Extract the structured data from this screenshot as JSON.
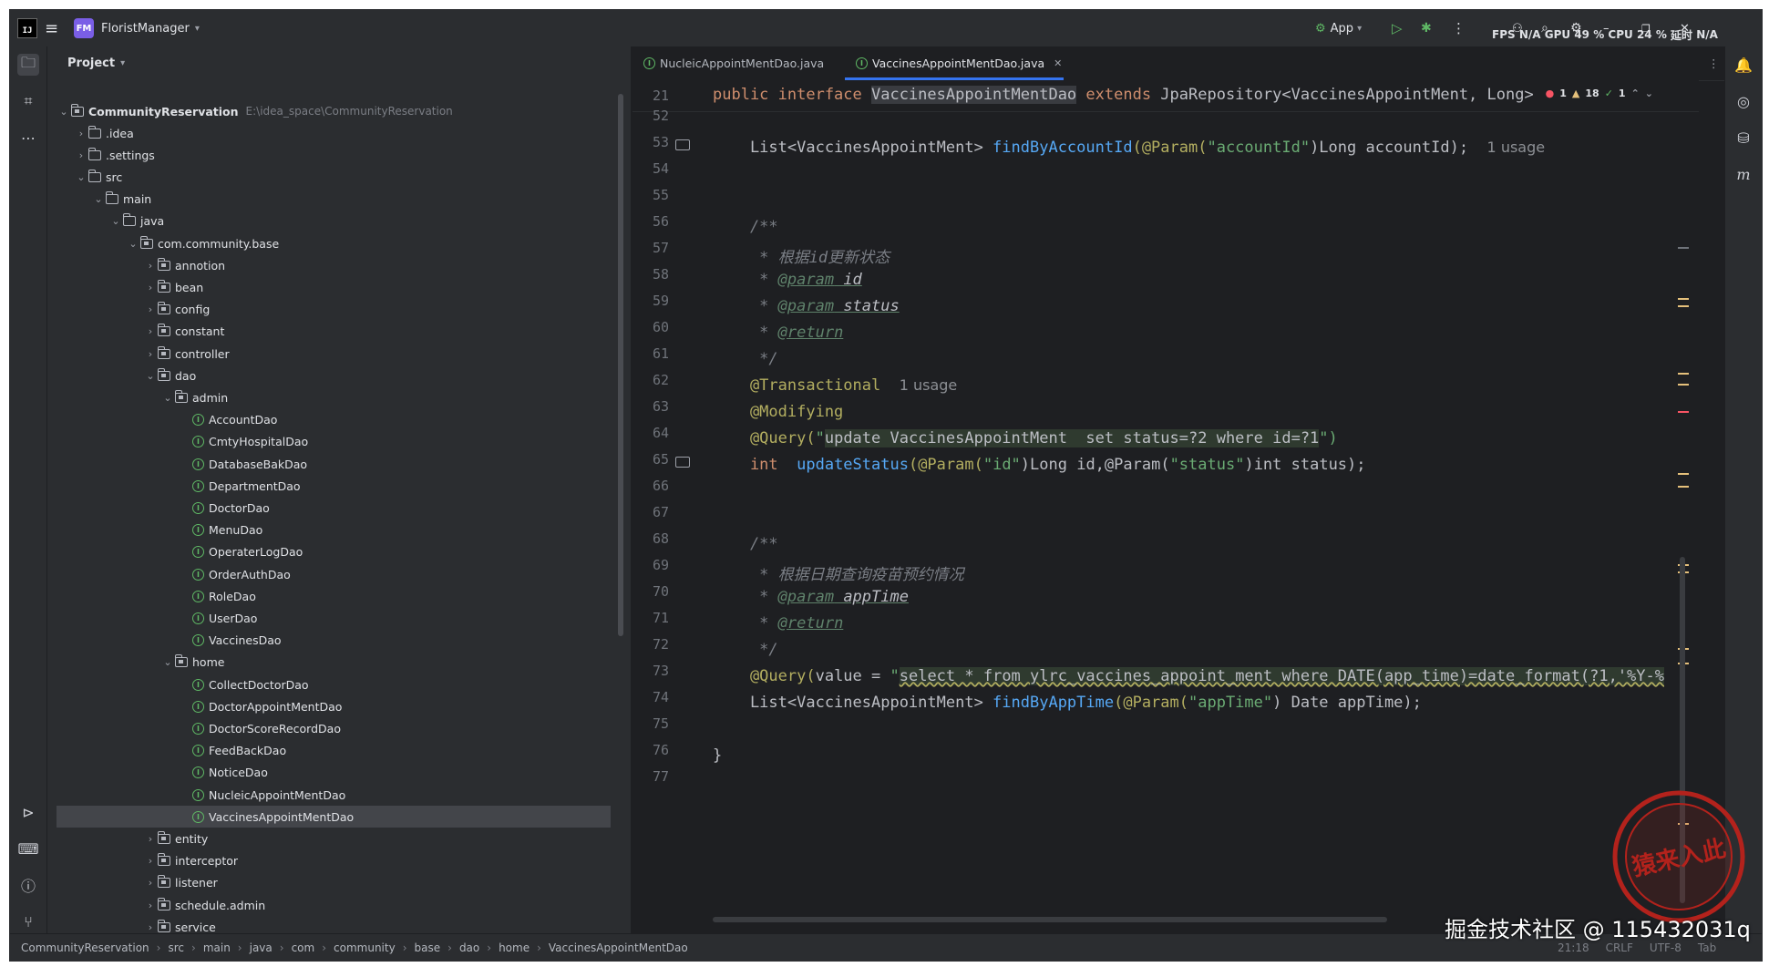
{
  "titlebar": {
    "project_badge": "FM",
    "project_name": "FloristManager",
    "run_config": "App",
    "fps_label": "FPS",
    "fps_value": "N/A",
    "gpu_label": "GPU",
    "gpu_value": "49 %",
    "cpu_label": "CPU",
    "cpu_value": "24 %",
    "latency_label": "延时",
    "latency_value": "N/A"
  },
  "project_panel": {
    "title": "Project",
    "root_name": "CommunityReservation",
    "root_path": "E:\\idea_space\\CommunityReservation",
    "items": [
      {
        "label": ".idea"
      },
      {
        "label": ".settings"
      },
      {
        "label": "src"
      },
      {
        "label": "main"
      },
      {
        "label": "java"
      },
      {
        "label": "com.community.base"
      },
      {
        "label": "annotion"
      },
      {
        "label": "bean"
      },
      {
        "label": "config"
      },
      {
        "label": "constant"
      },
      {
        "label": "controller"
      },
      {
        "label": "dao"
      },
      {
        "label": "admin"
      },
      {
        "label": "AccountDao"
      },
      {
        "label": "CmtyHospitalDao"
      },
      {
        "label": "DatabaseBakDao"
      },
      {
        "label": "DepartmentDao"
      },
      {
        "label": "DoctorDao"
      },
      {
        "label": "MenuDao"
      },
      {
        "label": "OperaterLogDao"
      },
      {
        "label": "OrderAuthDao"
      },
      {
        "label": "RoleDao"
      },
      {
        "label": "UserDao"
      },
      {
        "label": "VaccinesDao"
      },
      {
        "label": "home"
      },
      {
        "label": "CollectDoctorDao"
      },
      {
        "label": "DoctorAppointMentDao"
      },
      {
        "label": "DoctorScoreRecordDao"
      },
      {
        "label": "FeedBackDao"
      },
      {
        "label": "NoticeDao"
      },
      {
        "label": "NucleicAppointMentDao"
      },
      {
        "label": "VaccinesAppointMentDao"
      },
      {
        "label": "entity"
      },
      {
        "label": "interceptor"
      },
      {
        "label": "listener"
      },
      {
        "label": "schedule.admin"
      },
      {
        "label": "service"
      }
    ]
  },
  "editor": {
    "tabs": [
      {
        "label": "NucleicAppointMentDao.java"
      },
      {
        "label": "VaccinesAppointMentDao.java"
      }
    ],
    "inspections": {
      "errors": "1",
      "warnings": "18",
      "ok": "1"
    },
    "sticky_line_no": "21",
    "sticky_line": {
      "kw1": "public interface ",
      "name": "VaccinesAppointMentDao",
      "kw2": " extends ",
      "rest": "JpaRepository<VaccinesAppointMent, Long>"
    },
    "line_numbers": [
      "52",
      "53",
      "54",
      "55",
      "56",
      "57",
      "58",
      "59",
      "60",
      "61",
      "62",
      "63",
      "64",
      "65",
      "66",
      "67",
      "68",
      "69",
      "70",
      "71",
      "72",
      "73",
      "74",
      "75",
      "76",
      "77"
    ],
    "lines": {
      "l53_a": "    List<VaccinesAppointMent> ",
      "l53_fn": "findByAccountId",
      "l53_ann": "(@Param(",
      "l53_str": "\"accountId\"",
      "l53_b": ")Long accountId);",
      "l53_hint": "1 usage",
      "l56": "    /**",
      "l57": "     * 根据id更新状态",
      "l58_a": "     * ",
      "l58_tag": "@param",
      "l58_b": " id",
      "l59_a": "     * ",
      "l59_tag": "@param",
      "l59_b": " status",
      "l60_a": "     * ",
      "l60_tag": "@return",
      "l61": "     */",
      "l62_ann": "    @Transactional",
      "l62_hint": "1 usage",
      "l63_ann": "    @Modifying",
      "l64_ann": "    @Query(",
      "l64_q": "\"",
      "l64_sql1": "update VaccinesAppointMent  set status=?2 where id=?1",
      "l64_end": "\")",
      "l65_kw": "    int ",
      "l65_fn": " updateStatus",
      "l65_a": "(@Param(",
      "l65_s1": "\"id\"",
      "l65_b": ")Long id,@Param(",
      "l65_s2": "\"status\"",
      "l65_c": ")int status);",
      "l68": "    /**",
      "l69": "     * 根据日期查询疫苗预约情况",
      "l70_a": "     * ",
      "l70_tag": "@param",
      "l70_b": " appTime",
      "l71_a": "     * ",
      "l71_tag": "@return",
      "l72": "     */",
      "l73_ann": "    @Query(",
      "l73_a": "value = ",
      "l73_q": "\"",
      "l73_sql": "select * from ylrc_vaccines_appoint_ment where DATE(app_time)=date_format(?1,'%Y-%",
      "l74_a": "    List<VaccinesAppointMent> ",
      "l74_fn": "findByAppTime",
      "l74_b": "(@Param(",
      "l74_s": "\"appTime\"",
      "l74_c": ") Date appTime);",
      "l76": "}"
    }
  },
  "statusbar": {
    "breadcrumbs": [
      "CommunityReservation",
      "src",
      "main",
      "java",
      "com",
      "community",
      "base",
      "dao",
      "home",
      "VaccinesAppointMentDao"
    ],
    "position": "21:18",
    "line_sep": "CRLF",
    "encoding": "UTF-8",
    "indent": "Tab"
  },
  "watermark": {
    "text": "掘金技术社区 @ 115432031q",
    "stamp_text": "猿来入此"
  },
  "colors": {
    "background": "#1e1f22",
    "panel": "#2b2d30",
    "accent": "#3574f0",
    "keyword": "#cf8e6d",
    "function": "#56a8f5",
    "string": "#6aab73",
    "annotation": "#b3ae60",
    "comment": "#7a7e85",
    "stamp": "#b3221c"
  }
}
